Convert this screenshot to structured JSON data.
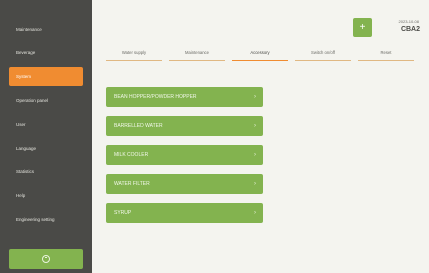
{
  "sidebar": {
    "items": [
      {
        "label": "Maintenance"
      },
      {
        "label": "Beverage"
      },
      {
        "label": "System"
      },
      {
        "label": "Operation panel"
      },
      {
        "label": "User"
      },
      {
        "label": "Language"
      },
      {
        "label": "Statistics"
      },
      {
        "label": "Help"
      },
      {
        "label": "Engineering setting"
      }
    ],
    "active_index": 2,
    "home_icon": "power-icon"
  },
  "header": {
    "add_label": "+",
    "status_line": "2023-10-08",
    "status_code": "CBA2"
  },
  "tabs": [
    {
      "label": "Water supply"
    },
    {
      "label": "Maintenance"
    },
    {
      "label": "Accessory"
    },
    {
      "label": "Switch on/off"
    },
    {
      "label": "Reset"
    }
  ],
  "active_tab": 2,
  "list": [
    {
      "label": "BEAN HOPPER/POWDER HOPPER"
    },
    {
      "label": "BARRELLED WATER"
    },
    {
      "label": "MILK COOLER"
    },
    {
      "label": "WATER FILTER"
    },
    {
      "label": "SYRUP"
    }
  ],
  "chevron": "›",
  "colors": {
    "sidebar": "#4a4a47",
    "accent_orange": "#f08c31",
    "accent_green": "#83b34f",
    "background": "#f4f4ef"
  }
}
